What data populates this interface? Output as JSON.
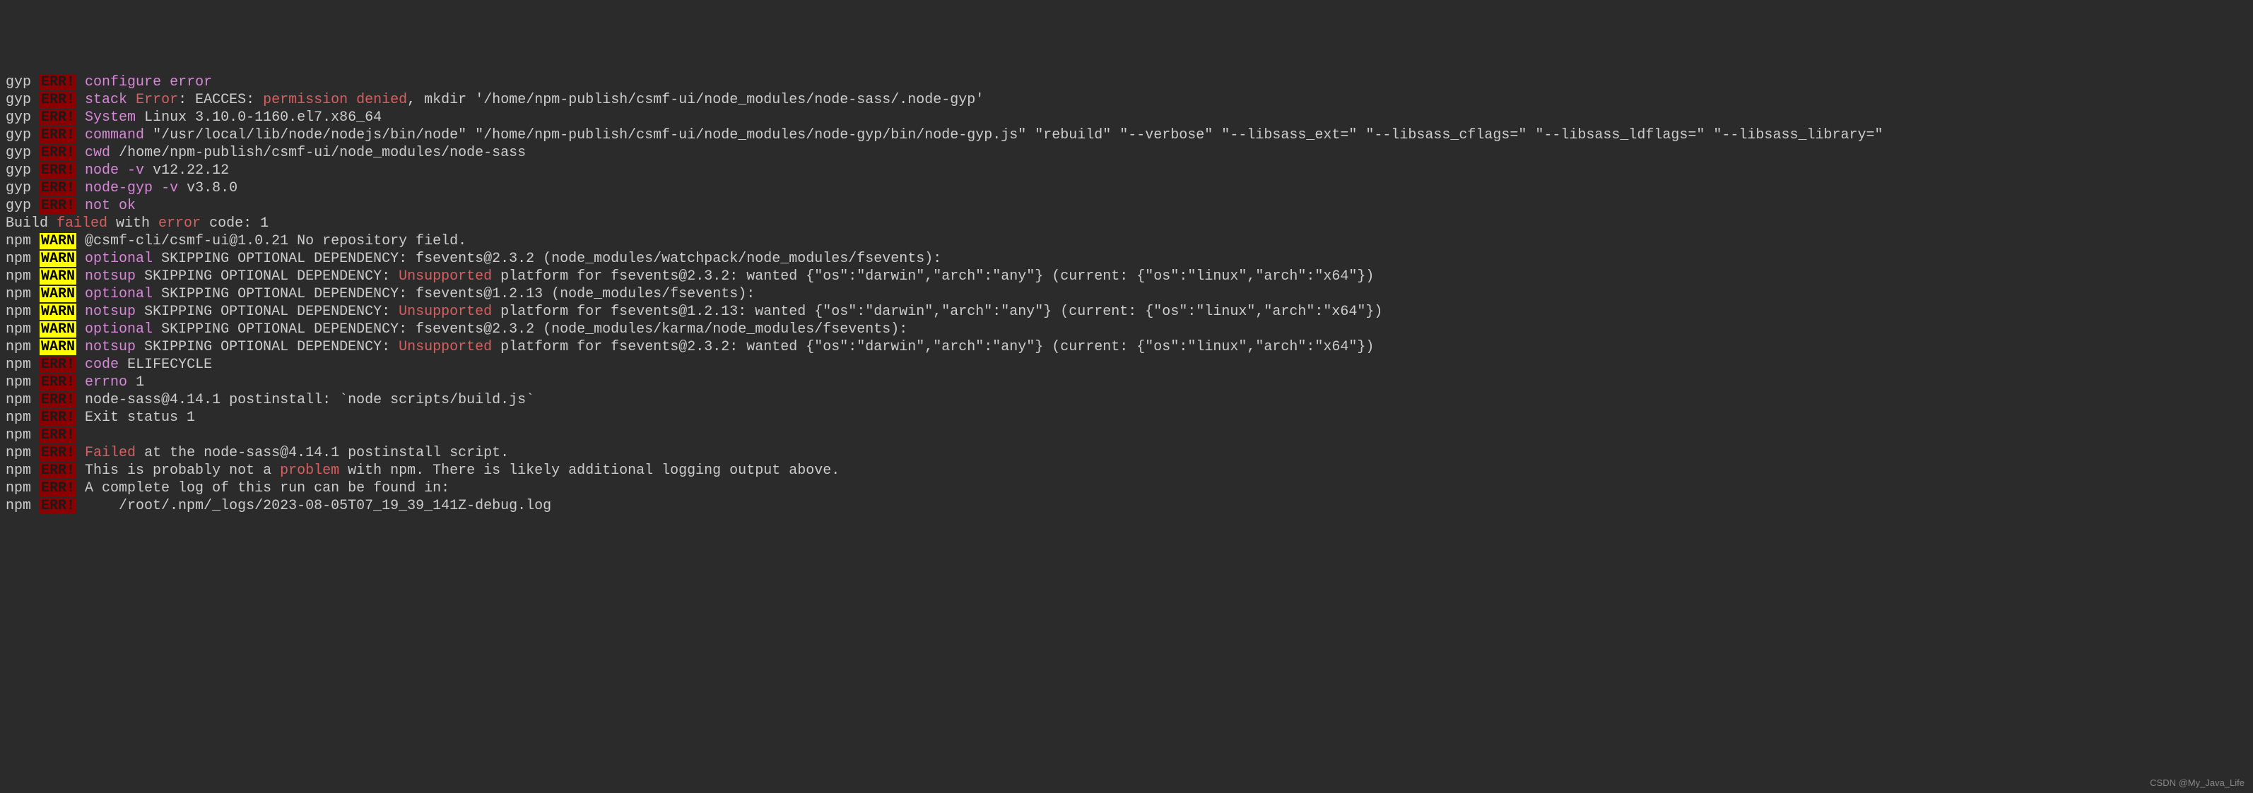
{
  "lines": [
    {
      "segments": [
        {
          "cls": "gyp",
          "text": "gyp "
        },
        {
          "cls": "err",
          "text": "ERR!"
        },
        {
          "cls": "white",
          "text": " "
        },
        {
          "cls": "magenta",
          "text": "configure error"
        }
      ]
    },
    {
      "segments": [
        {
          "cls": "gyp",
          "text": "gyp "
        },
        {
          "cls": "err",
          "text": "ERR!"
        },
        {
          "cls": "white",
          "text": " "
        },
        {
          "cls": "magenta",
          "text": "stack"
        },
        {
          "cls": "white",
          "text": " "
        },
        {
          "cls": "orange",
          "text": "Error"
        },
        {
          "cls": "white",
          "text": ": EACCES: "
        },
        {
          "cls": "orange",
          "text": "permission denied"
        },
        {
          "cls": "white",
          "text": ", mkdir '/home/npm-publish/csmf-ui/node_modules/node-sass/.node-gyp'"
        }
      ]
    },
    {
      "segments": [
        {
          "cls": "gyp",
          "text": "gyp "
        },
        {
          "cls": "err",
          "text": "ERR!"
        },
        {
          "cls": "white",
          "text": " "
        },
        {
          "cls": "magenta",
          "text": "System"
        },
        {
          "cls": "white",
          "text": " Linux 3.10.0-1160.el7.x86_64"
        }
      ]
    },
    {
      "segments": [
        {
          "cls": "gyp",
          "text": "gyp "
        },
        {
          "cls": "err",
          "text": "ERR!"
        },
        {
          "cls": "white",
          "text": " "
        },
        {
          "cls": "magenta",
          "text": "command"
        },
        {
          "cls": "white",
          "text": " \"/usr/local/lib/node/nodejs/bin/node\" \"/home/npm-publish/csmf-ui/node_modules/node-gyp/bin/node-gyp.js\" \"rebuild\" \"--verbose\" \"--libsass_ext=\" \"--libsass_cflags=\" \"--libsass_ldflags=\" \"--libsass_library=\""
        }
      ]
    },
    {
      "segments": [
        {
          "cls": "gyp",
          "text": "gyp "
        },
        {
          "cls": "err",
          "text": "ERR!"
        },
        {
          "cls": "white",
          "text": " "
        },
        {
          "cls": "magenta",
          "text": "cwd"
        },
        {
          "cls": "white",
          "text": " /home/npm-publish/csmf-ui/node_modules/node-sass"
        }
      ]
    },
    {
      "segments": [
        {
          "cls": "gyp",
          "text": "gyp "
        },
        {
          "cls": "err",
          "text": "ERR!"
        },
        {
          "cls": "white",
          "text": " "
        },
        {
          "cls": "magenta",
          "text": "node -v"
        },
        {
          "cls": "white",
          "text": " v12.22.12"
        }
      ]
    },
    {
      "segments": [
        {
          "cls": "gyp",
          "text": "gyp "
        },
        {
          "cls": "err",
          "text": "ERR!"
        },
        {
          "cls": "white",
          "text": " "
        },
        {
          "cls": "magenta",
          "text": "node-gyp -v"
        },
        {
          "cls": "white",
          "text": " v3.8.0"
        }
      ]
    },
    {
      "segments": [
        {
          "cls": "gyp",
          "text": "gyp "
        },
        {
          "cls": "err",
          "text": "ERR!"
        },
        {
          "cls": "white",
          "text": " "
        },
        {
          "cls": "magenta",
          "text": "not ok"
        }
      ]
    },
    {
      "segments": [
        {
          "cls": "white",
          "text": "Build "
        },
        {
          "cls": "orange",
          "text": "failed"
        },
        {
          "cls": "white",
          "text": " with "
        },
        {
          "cls": "orange",
          "text": "error"
        },
        {
          "cls": "white",
          "text": " code: 1"
        }
      ]
    },
    {
      "segments": [
        {
          "cls": "white",
          "text": "npm "
        },
        {
          "cls": "warn",
          "text": "WARN"
        },
        {
          "cls": "white",
          "text": " @csmf-cli/csmf-ui@1.0.21 No repository field."
        }
      ]
    },
    {
      "segments": [
        {
          "cls": "white",
          "text": "npm "
        },
        {
          "cls": "warn",
          "text": "WARN"
        },
        {
          "cls": "white",
          "text": " "
        },
        {
          "cls": "magenta",
          "text": "optional"
        },
        {
          "cls": "white",
          "text": " SKIPPING OPTIONAL DEPENDENCY: fsevents@2.3.2 (node_modules/watchpack/node_modules/fsevents):"
        }
      ]
    },
    {
      "segments": [
        {
          "cls": "white",
          "text": "npm "
        },
        {
          "cls": "warn",
          "text": "WARN"
        },
        {
          "cls": "white",
          "text": " "
        },
        {
          "cls": "magenta",
          "text": "notsup"
        },
        {
          "cls": "white",
          "text": " SKIPPING OPTIONAL DEPENDENCY: "
        },
        {
          "cls": "orange",
          "text": "Unsupported"
        },
        {
          "cls": "white",
          "text": " platform for fsevents@2.3.2: wanted {\"os\":\"darwin\",\"arch\":\"any\"} (current: {\"os\":\"linux\",\"arch\":\"x64\"})"
        }
      ]
    },
    {
      "segments": [
        {
          "cls": "white",
          "text": "npm "
        },
        {
          "cls": "warn",
          "text": "WARN"
        },
        {
          "cls": "white",
          "text": " "
        },
        {
          "cls": "magenta",
          "text": "optional"
        },
        {
          "cls": "white",
          "text": " SKIPPING OPTIONAL DEPENDENCY: fsevents@1.2.13 (node_modules/fsevents):"
        }
      ]
    },
    {
      "segments": [
        {
          "cls": "white",
          "text": "npm "
        },
        {
          "cls": "warn",
          "text": "WARN"
        },
        {
          "cls": "white",
          "text": " "
        },
        {
          "cls": "magenta",
          "text": "notsup"
        },
        {
          "cls": "white",
          "text": " SKIPPING OPTIONAL DEPENDENCY: "
        },
        {
          "cls": "orange",
          "text": "Unsupported"
        },
        {
          "cls": "white",
          "text": " platform for fsevents@1.2.13: wanted {\"os\":\"darwin\",\"arch\":\"any\"} (current: {\"os\":\"linux\",\"arch\":\"x64\"})"
        }
      ]
    },
    {
      "segments": [
        {
          "cls": "white",
          "text": "npm "
        },
        {
          "cls": "warn",
          "text": "WARN"
        },
        {
          "cls": "white",
          "text": " "
        },
        {
          "cls": "magenta",
          "text": "optional"
        },
        {
          "cls": "white",
          "text": " SKIPPING OPTIONAL DEPENDENCY: fsevents@2.3.2 (node_modules/karma/node_modules/fsevents):"
        }
      ]
    },
    {
      "segments": [
        {
          "cls": "white",
          "text": "npm "
        },
        {
          "cls": "warn",
          "text": "WARN"
        },
        {
          "cls": "white",
          "text": " "
        },
        {
          "cls": "magenta",
          "text": "notsup"
        },
        {
          "cls": "white",
          "text": " SKIPPING OPTIONAL DEPENDENCY: "
        },
        {
          "cls": "orange",
          "text": "Unsupported"
        },
        {
          "cls": "white",
          "text": " platform for fsevents@2.3.2: wanted {\"os\":\"darwin\",\"arch\":\"any\"} (current: {\"os\":\"linux\",\"arch\":\"x64\"})"
        }
      ]
    },
    {
      "segments": [
        {
          "cls": "white",
          "text": ""
        }
      ]
    },
    {
      "segments": [
        {
          "cls": "white",
          "text": "npm "
        },
        {
          "cls": "err",
          "text": "ERR!"
        },
        {
          "cls": "white",
          "text": " "
        },
        {
          "cls": "magenta",
          "text": "code"
        },
        {
          "cls": "white",
          "text": " ELIFECYCLE"
        }
      ]
    },
    {
      "segments": [
        {
          "cls": "white",
          "text": "npm "
        },
        {
          "cls": "err",
          "text": "ERR!"
        },
        {
          "cls": "white",
          "text": " "
        },
        {
          "cls": "magenta",
          "text": "errno"
        },
        {
          "cls": "white",
          "text": " 1"
        }
      ]
    },
    {
      "segments": [
        {
          "cls": "white",
          "text": "npm "
        },
        {
          "cls": "err",
          "text": "ERR!"
        },
        {
          "cls": "white",
          "text": " node-sass@4.14.1 postinstall: `node scripts/build.js`"
        }
      ]
    },
    {
      "segments": [
        {
          "cls": "white",
          "text": "npm "
        },
        {
          "cls": "err",
          "text": "ERR!"
        },
        {
          "cls": "white",
          "text": " Exit status 1"
        }
      ]
    },
    {
      "segments": [
        {
          "cls": "white",
          "text": "npm "
        },
        {
          "cls": "err",
          "text": "ERR!"
        }
      ]
    },
    {
      "segments": [
        {
          "cls": "white",
          "text": "npm "
        },
        {
          "cls": "err",
          "text": "ERR!"
        },
        {
          "cls": "white",
          "text": " "
        },
        {
          "cls": "orange",
          "text": "Failed"
        },
        {
          "cls": "white",
          "text": " at the node-sass@4.14.1 postinstall script."
        }
      ]
    },
    {
      "segments": [
        {
          "cls": "white",
          "text": "npm "
        },
        {
          "cls": "err",
          "text": "ERR!"
        },
        {
          "cls": "white",
          "text": " This is probably not a "
        },
        {
          "cls": "orange",
          "text": "problem"
        },
        {
          "cls": "white",
          "text": " with npm. There is likely additional logging output above."
        }
      ]
    },
    {
      "segments": [
        {
          "cls": "white",
          "text": ""
        }
      ]
    },
    {
      "segments": [
        {
          "cls": "white",
          "text": "npm "
        },
        {
          "cls": "err",
          "text": "ERR!"
        },
        {
          "cls": "white",
          "text": " A complete log of this run can be found in:"
        }
      ]
    },
    {
      "segments": [
        {
          "cls": "white",
          "text": "npm "
        },
        {
          "cls": "err",
          "text": "ERR!"
        },
        {
          "cls": "white",
          "text": "     /root/.npm/_logs/2023-08-05T07_19_39_141Z-debug.log"
        }
      ]
    }
  ],
  "watermark": "CSDN @My_Java_Life"
}
